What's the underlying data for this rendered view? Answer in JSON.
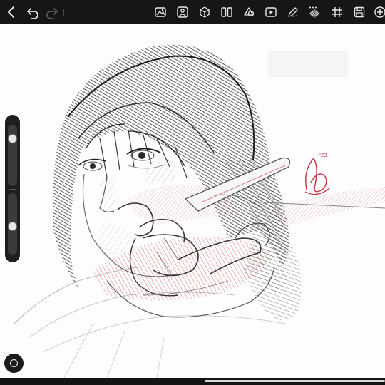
{
  "toolbar": {
    "left_icons": [
      "back-chevron-icon",
      "undo-icon",
      "redo-icon"
    ],
    "right_icons": [
      "image-gallery-icon",
      "reference-image-icon",
      "3d-cube-icon",
      "split-view-icon",
      "shapes-icon",
      "video-play-icon",
      "pen-tool-icon",
      "symmetry-icon",
      "grid-icon",
      "save-icon",
      "add-icon"
    ]
  },
  "canvas": {
    "signature_year": "'23",
    "stroke_count": "2939strokes"
  },
  "side_panel": {
    "brush_size_level": 0.18,
    "opacity_level": 0.55
  },
  "colors": {
    "toolbar_bg": "#161616",
    "sketch_stroke": "#2a2a2a",
    "accent_red": "#c2333a"
  }
}
